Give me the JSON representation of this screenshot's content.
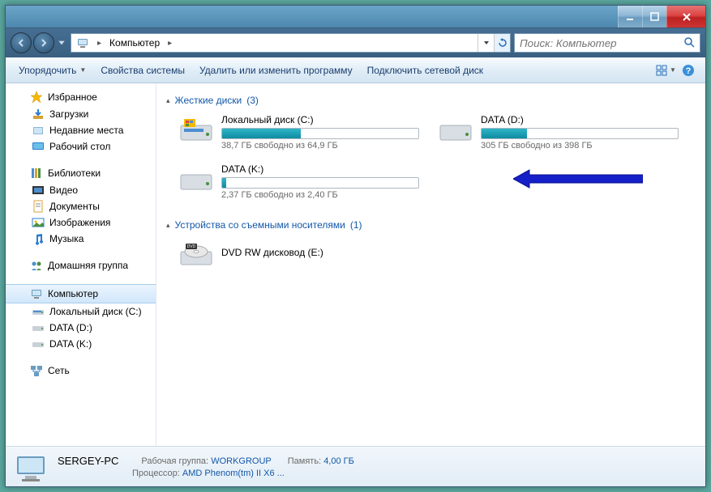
{
  "titlebar": {
    "blur1": "",
    "blur2": ""
  },
  "address": {
    "root_label": "Компьютер"
  },
  "search": {
    "placeholder": "Поиск: Компьютер"
  },
  "toolbar": {
    "organize": "Упорядочить",
    "properties": "Свойства системы",
    "uninstall": "Удалить или изменить программу",
    "mapdrive": "Подключить сетевой диск"
  },
  "sidebar": {
    "favorites": {
      "label": "Избранное"
    },
    "downloads": {
      "label": "Загрузки"
    },
    "recent": {
      "label": "Недавние места"
    },
    "desktop": {
      "label": "Рабочий стол"
    },
    "libraries": {
      "label": "Библиотеки"
    },
    "videos": {
      "label": "Видео"
    },
    "documents": {
      "label": "Документы"
    },
    "pictures": {
      "label": "Изображения"
    },
    "music": {
      "label": "Музыка"
    },
    "homegroup": {
      "label": "Домашняя группа"
    },
    "computer": {
      "label": "Компьютер"
    },
    "drive_c": {
      "label": "Локальный диск (C:)"
    },
    "drive_d": {
      "label": "DATA (D:)"
    },
    "drive_k": {
      "label": "DATA (K:)"
    },
    "network": {
      "label": "Сеть"
    }
  },
  "content": {
    "hdd_section": {
      "label": "Жесткие диски",
      "count": "(3)"
    },
    "removable_section": {
      "label": "Устройства со съемными носителями",
      "count": "(1)"
    },
    "drives": {
      "c": {
        "name": "Локальный диск (C:)",
        "free": "38,7 ГБ свободно из 64,9 ГБ",
        "used_pct": 40
      },
      "d": {
        "name": "DATA (D:)",
        "free": "305 ГБ свободно из 398 ГБ",
        "used_pct": 23
      },
      "k": {
        "name": "DATA (K:)",
        "free": "2,37 ГБ свободно из 2,40 ГБ",
        "used_pct": 2
      },
      "dvd": {
        "name": "DVD RW дисковод (E:)"
      }
    }
  },
  "status": {
    "pcname": "SERGEY-PC",
    "workgroup_k": "Рабочая группа:",
    "workgroup_v": "WORKGROUP",
    "memory_k": "Память:",
    "memory_v": "4,00 ГБ",
    "cpu_k": "Процессор:",
    "cpu_v": "AMD Phenom(tm) II X6 ..."
  }
}
